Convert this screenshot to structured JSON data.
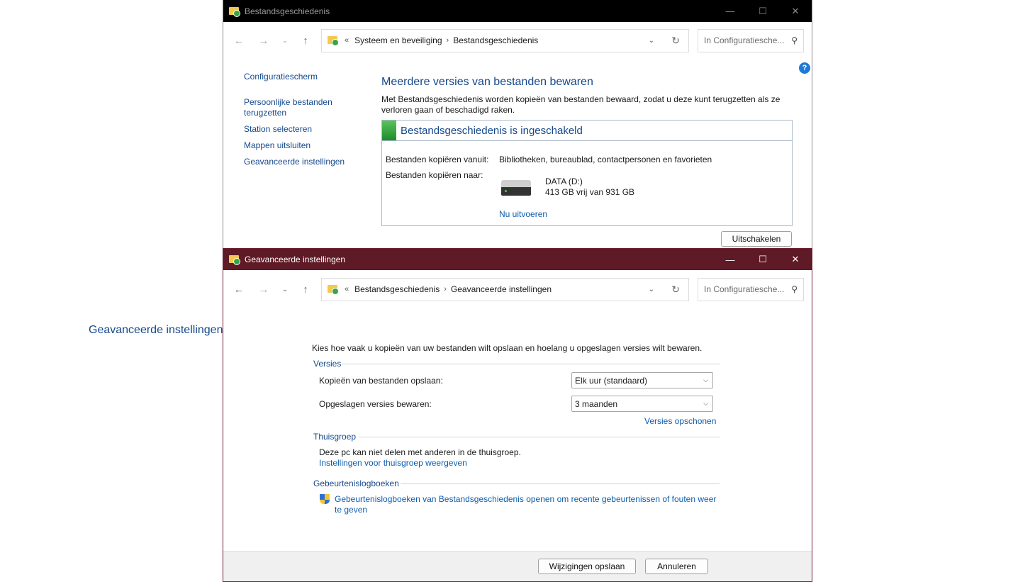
{
  "window1": {
    "title": "Bestandsgeschiedenis",
    "address": {
      "overflow": "«",
      "crumbs": [
        "Systeem en beveiliging",
        "Bestandsgeschiedenis"
      ]
    },
    "search_placeholder": "In Configuratiesche...",
    "sidebar": {
      "home": "Configuratiescherm",
      "items": [
        {
          "label": "Persoonlijke bestanden terugzetten"
        },
        {
          "label": "Station selecteren"
        },
        {
          "label": "Mappen uitsluiten"
        },
        {
          "label": "Geavanceerde instellingen"
        }
      ]
    },
    "main": {
      "heading": "Meerdere versies van bestanden bewaren",
      "description": "Met Bestandsgeschiedenis worden kopieën van bestanden bewaard, zodat u deze kunt terugzetten als ze verloren gaan of beschadigd raken.",
      "status_title": "Bestandsgeschiedenis is ingeschakeld",
      "copy_from_label": "Bestanden kopiëren vanuit:",
      "copy_from_value": "Bibliotheken, bureaublad, contactpersonen en favorieten",
      "copy_to_label": "Bestanden kopiëren naar:",
      "drive_name": "DATA (D:)",
      "drive_space": "413 GB vrij van 931 GB",
      "run_now": "Nu uitvoeren",
      "disable_button": "Uitschakelen"
    }
  },
  "window2": {
    "title": "Geavanceerde instellingen",
    "address": {
      "overflow": "«",
      "crumbs": [
        "Bestandsgeschiedenis",
        "Geavanceerde instellingen"
      ]
    },
    "search_placeholder": "In Configuratiesche...",
    "heading": "Geavanceerde instellingen",
    "description": "Kies hoe vaak u kopieën van uw bestanden wilt opslaan en hoelang u opgeslagen versies wilt bewaren.",
    "versions": {
      "label": "Versies",
      "save_copies_label": "Kopieën van bestanden opslaan:",
      "save_copies_value": "Elk uur (standaard)",
      "keep_versions_label": "Opgeslagen versies bewaren:",
      "keep_versions_value": "3 maanden",
      "cleanup_link": "Versies opschonen"
    },
    "homegroup": {
      "label": "Thuisgroep",
      "text": "Deze pc kan niet delen met anderen in de thuisgroep.",
      "link": "Instellingen voor thuisgroep weergeven"
    },
    "eventlogs": {
      "label": "Gebeurtenislogboeken",
      "link_line1": "Gebeurtenislogboeken van Bestandsgeschiedenis openen om recente gebeurtenissen of fouten weer",
      "link_line2": "te geven"
    },
    "save_button": "Wijzigingen opslaan",
    "cancel_button": "Annuleren"
  }
}
